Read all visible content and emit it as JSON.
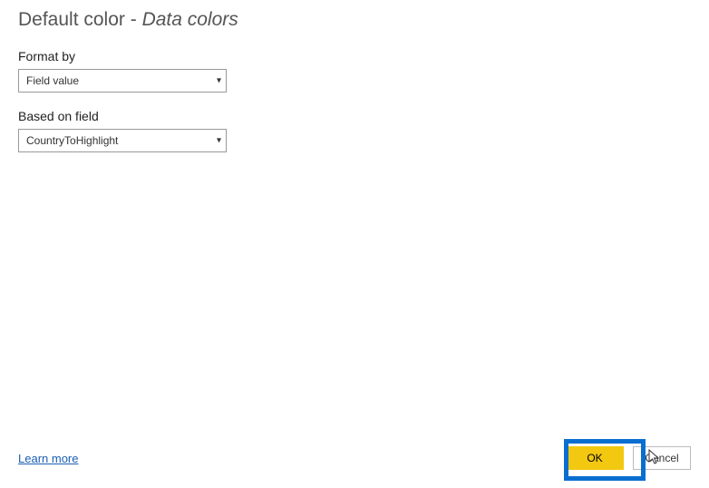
{
  "title_prefix": "Default color - ",
  "title_emphasis": "Data colors",
  "format_by": {
    "label": "Format by",
    "value": "Field value"
  },
  "based_on_field": {
    "label": "Based on field",
    "value": "CountryToHighlight"
  },
  "learn_more": "Learn more",
  "buttons": {
    "ok": "OK",
    "cancel": "Cancel"
  }
}
